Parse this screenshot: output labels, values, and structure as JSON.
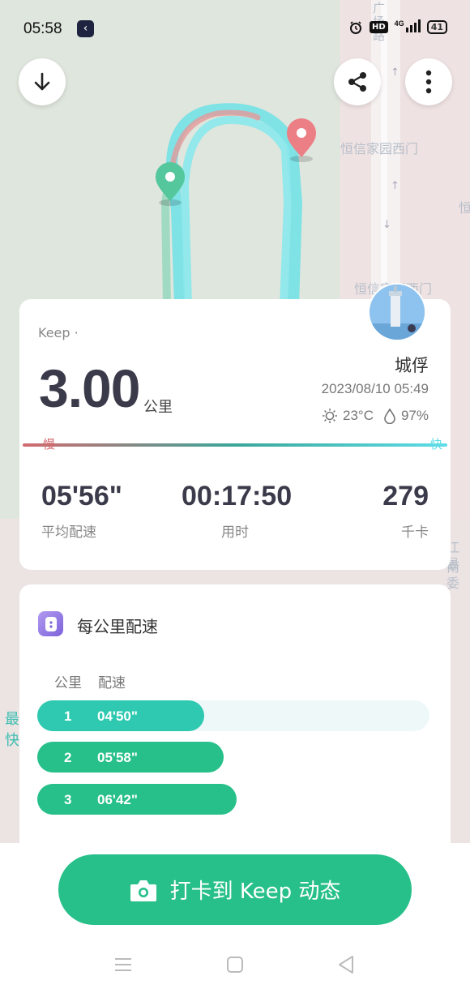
{
  "status_bar": {
    "time": "05:58",
    "hd_label": "HD",
    "network_label": "4G",
    "battery": "41"
  },
  "map": {
    "labels": [
      "恒信家园西门",
      "恒信家园西门",
      "广场路",
      "恒",
      "江南",
      "县委"
    ]
  },
  "summary": {
    "brand": "Keep ·",
    "distance": "3.00",
    "distance_unit": "公里",
    "username": "城俘",
    "datetime": "2023/08/10 05:49",
    "temperature": "23°C",
    "humidity": "97%",
    "speed_slow": "慢",
    "speed_fast": "快",
    "stats": [
      {
        "value": "05'56\"",
        "label": "平均配速"
      },
      {
        "value": "00:17:50",
        "label": "用时"
      },
      {
        "value": "279",
        "label": "千卡"
      }
    ]
  },
  "pace": {
    "title": "每公里配速",
    "col_km": "公里",
    "col_pace": "配速",
    "fastest_tag": "最快",
    "rows": [
      {
        "km": "1",
        "pace": "04'50\"",
        "fill": 0.425,
        "color": "#2ec9b0"
      },
      {
        "km": "2",
        "pace": "05'58\"",
        "fill": 0.475,
        "color": "#27c08a"
      },
      {
        "km": "3",
        "pace": "06'42\"",
        "fill": 0.508,
        "color": "#27c08a"
      }
    ]
  },
  "checkin": {
    "label": "打卡到 Keep 动态"
  },
  "colors": {
    "accent_green": "#27c08a",
    "route_cyan": "#6fe0e6",
    "route_red": "#e59a9a"
  }
}
